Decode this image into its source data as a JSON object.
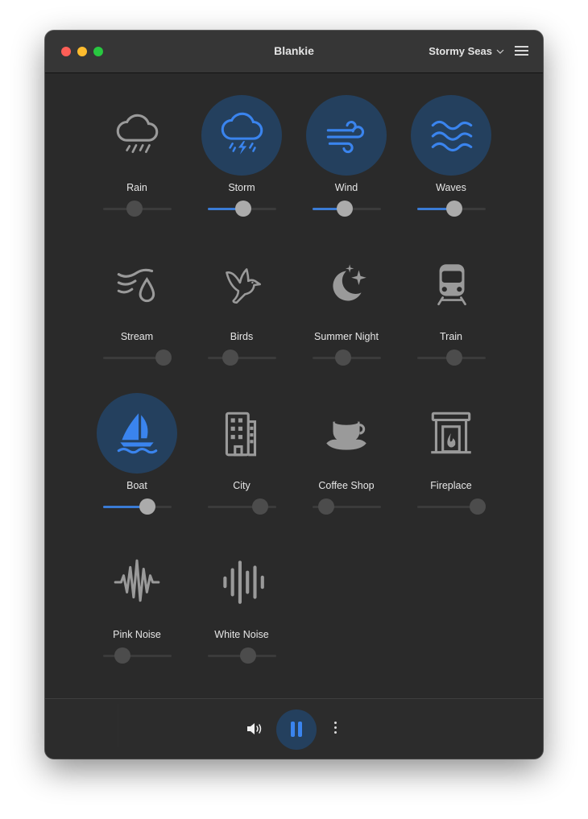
{
  "window": {
    "title": "Blankie",
    "preset": "Stormy Seas"
  },
  "colors": {
    "accent": "#3a84ee",
    "active_bg": "#24405e",
    "inactive_icon": "#9a9a9a",
    "window_bg": "#2a2a2a"
  },
  "sounds": [
    {
      "name": "Rain",
      "icon": "cloud-rain-icon",
      "active": false,
      "volume": 0.45
    },
    {
      "name": "Storm",
      "icon": "cloud-bolt-rain-icon",
      "active": true,
      "volume": 0.52
    },
    {
      "name": "Wind",
      "icon": "wind-icon",
      "active": true,
      "volume": 0.46
    },
    {
      "name": "Waves",
      "icon": "water-waves-icon",
      "active": true,
      "volume": 0.55
    },
    {
      "name": "Stream",
      "icon": "stream-drop-icon",
      "active": false,
      "volume": 1.0
    },
    {
      "name": "Birds",
      "icon": "bird-icon",
      "active": false,
      "volume": 0.28
    },
    {
      "name": "Summer Night",
      "icon": "moon-stars-icon",
      "active": false,
      "volume": 0.43
    },
    {
      "name": "Train",
      "icon": "tram-icon",
      "active": false,
      "volume": 0.55
    },
    {
      "name": "Boat",
      "icon": "sailboat-icon",
      "active": true,
      "volume": 0.69
    },
    {
      "name": "City",
      "icon": "building-icon",
      "active": false,
      "volume": 0.85
    },
    {
      "name": "Coffee Shop",
      "icon": "cup-saucer-icon",
      "active": false,
      "volume": 0.11
    },
    {
      "name": "Fireplace",
      "icon": "fireplace-icon",
      "active": false,
      "volume": 1.0
    },
    {
      "name": "Pink Noise",
      "icon": "waveform-path-icon",
      "active": false,
      "volume": 0.22
    },
    {
      "name": "White Noise",
      "icon": "waveform-icon",
      "active": false,
      "volume": 0.62
    }
  ],
  "footer": {
    "volume_icon": "speaker-wave-icon",
    "playback_state": "playing",
    "play_pause_icon": "pause-icon",
    "more_icon": "ellipsis-vertical-icon"
  }
}
